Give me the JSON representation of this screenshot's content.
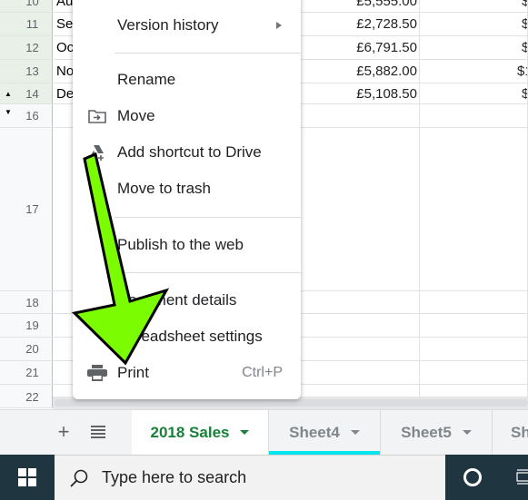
{
  "grid": {
    "rows": [
      {
        "num": "10",
        "a": "Au",
        "d": "£5,555.00",
        "e": "$",
        "selected": true
      },
      {
        "num": "11",
        "a": "Se",
        "d": "£2,728.50",
        "e": "$",
        "selected": true
      },
      {
        "num": "12",
        "a": "Oc",
        "d": "£6,791.50",
        "e": "$",
        "selected": true
      },
      {
        "num": "13",
        "a": "No",
        "d": "£5,882.00",
        "e": "$1",
        "selected": true
      },
      {
        "num": "14",
        "a": "De",
        "d": "£5,108.50",
        "e": "$",
        "selected": true
      },
      {
        "num": "16",
        "a": "",
        "d": "",
        "e": ""
      },
      {
        "num": "17",
        "a": "",
        "d": "",
        "e": ""
      },
      {
        "num": "18",
        "a": "",
        "d": "",
        "e": ""
      },
      {
        "num": "19",
        "a": "",
        "d": "",
        "e": ""
      },
      {
        "num": "20",
        "a": "",
        "d": "",
        "e": ""
      },
      {
        "num": "21",
        "a": "",
        "d": "",
        "e": ""
      },
      {
        "num": "22",
        "a": "",
        "d": "",
        "e": ""
      }
    ],
    "group_collapse_up": "▲",
    "group_expand_down": "▼"
  },
  "menu": {
    "items": [
      {
        "label": "Version history",
        "icon": "",
        "has_submenu": true
      },
      {
        "label": "Rename",
        "icon": ""
      },
      {
        "label": "Move",
        "icon": "folder-move-icon"
      },
      {
        "label": "Add shortcut to Drive",
        "icon": "drive-shortcut-icon"
      },
      {
        "label": "Move to trash",
        "icon": ""
      },
      {
        "label": "Publish to the web",
        "icon": ""
      },
      {
        "label": "Document details",
        "icon": ""
      },
      {
        "label": "Spreadsheet settings",
        "icon": ""
      },
      {
        "label": "Print",
        "icon": "printer-icon",
        "shortcut": "Ctrl+P"
      }
    ]
  },
  "sheet_tabs": {
    "add_icon": "+",
    "tabs": [
      {
        "label": "2018 Sales",
        "active": true
      },
      {
        "label": "Sheet4",
        "active": false,
        "hovered": true
      },
      {
        "label": "Sheet5",
        "active": false
      },
      {
        "label": "Sh",
        "active": false
      }
    ]
  },
  "taskbar": {
    "search_placeholder": "Type here to search"
  },
  "annotation": {
    "arrow_color": "#7cfc00",
    "arrow_outline": "#000000"
  }
}
